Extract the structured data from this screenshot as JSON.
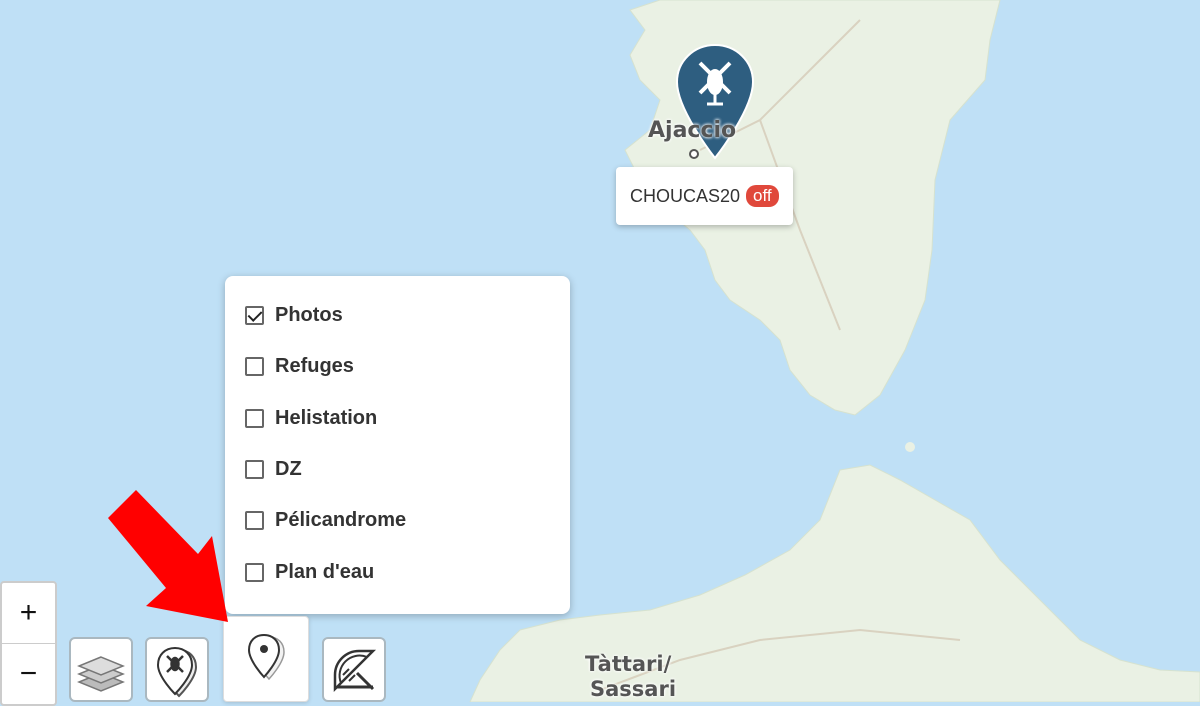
{
  "map": {
    "water_color": "#bfe0f6",
    "land_color": "#eaf1e4",
    "place_labels": [
      {
        "name": "Ajaccio"
      },
      {
        "name": "Tàttari/"
      },
      {
        "name": "Sassari"
      }
    ]
  },
  "marker": {
    "icon": "helicopter-icon",
    "color": "#2e5e80",
    "popup": {
      "label": "CHOUCAS20",
      "status": "off",
      "status_color": "#e0483b"
    }
  },
  "layer_panel": {
    "items": [
      {
        "label": "Photos",
        "checked": true
      },
      {
        "label": "Refuges",
        "checked": false
      },
      {
        "label": "Helistation",
        "checked": false
      },
      {
        "label": "DZ",
        "checked": false
      },
      {
        "label": "Pélicandrome",
        "checked": false
      },
      {
        "label": "Plan d'eau",
        "checked": false
      }
    ]
  },
  "zoom": {
    "in_label": "+",
    "out_label": "−"
  },
  "toolbar": {
    "buttons": [
      {
        "icon": "layers-icon"
      },
      {
        "icon": "helicopter-marker-icon"
      },
      {
        "icon": "poi-marker-icon",
        "active": true
      },
      {
        "icon": "measure-icon"
      }
    ]
  },
  "annotation": {
    "arrow_color": "#ff0000"
  }
}
